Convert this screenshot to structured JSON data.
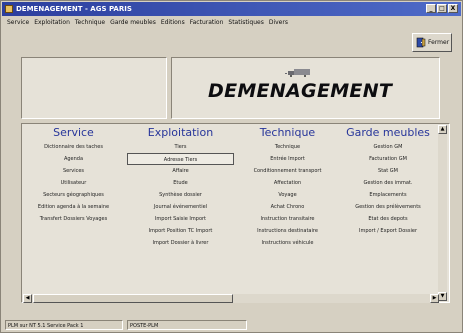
{
  "window": {
    "title": "DEMENAGEMENT - AGS PARIS",
    "controls": [
      "_",
      "□",
      "X"
    ]
  },
  "menu": [
    "Service",
    "Exploitation",
    "Technique",
    "Garde meubles",
    "Editions",
    "Facturation",
    "Statistiques",
    "Divers"
  ],
  "close_button": {
    "label": "Fermer",
    "icon": "exit-door-icon"
  },
  "brand": {
    "title": "DEMENAGEMENT",
    "icon": "truck-icon"
  },
  "columns": {
    "service": {
      "header": "Service",
      "items": [
        "Dictionnaire des taches",
        "Agenda",
        "Services",
        "Utilisateur",
        "Secteurs géographiques",
        "Edition agenda à la semaine",
        "Transfert Dossiers  Voyages"
      ]
    },
    "exploitation": {
      "header": "Exploitation",
      "items": [
        "Tiers",
        "Adresse Tiers",
        "Affaire",
        "Etude",
        "Synthèse dossier",
        "Journal événementiel",
        "Import Saisie Import",
        "Import Position TC Import",
        "Import Dossier à livrer"
      ]
    },
    "technique": {
      "header": "Technique",
      "items": [
        "Technique",
        "Entrée Import",
        "Conditionnement transport",
        "Affectation",
        "Voyage",
        "Achat Chrono",
        "Instruction transitaire",
        "Instructions destinataire",
        "Instructions véhicule"
      ]
    },
    "garde": {
      "header": "Garde meubles",
      "items": [
        "Gestion GM",
        "Facturation GM",
        "Stat GM",
        "Gestion des immat.",
        "Emplacements",
        "Gestion des prélèvements",
        "Etat des depots",
        "Import / Export Dossier"
      ]
    }
  },
  "status": {
    "os": "PLM sur NT 5.1  Service Pack 1",
    "station": "POSTE-PLM"
  },
  "colors": {
    "header_blue": "#27359a",
    "titlebar": "#2c3f9e"
  }
}
